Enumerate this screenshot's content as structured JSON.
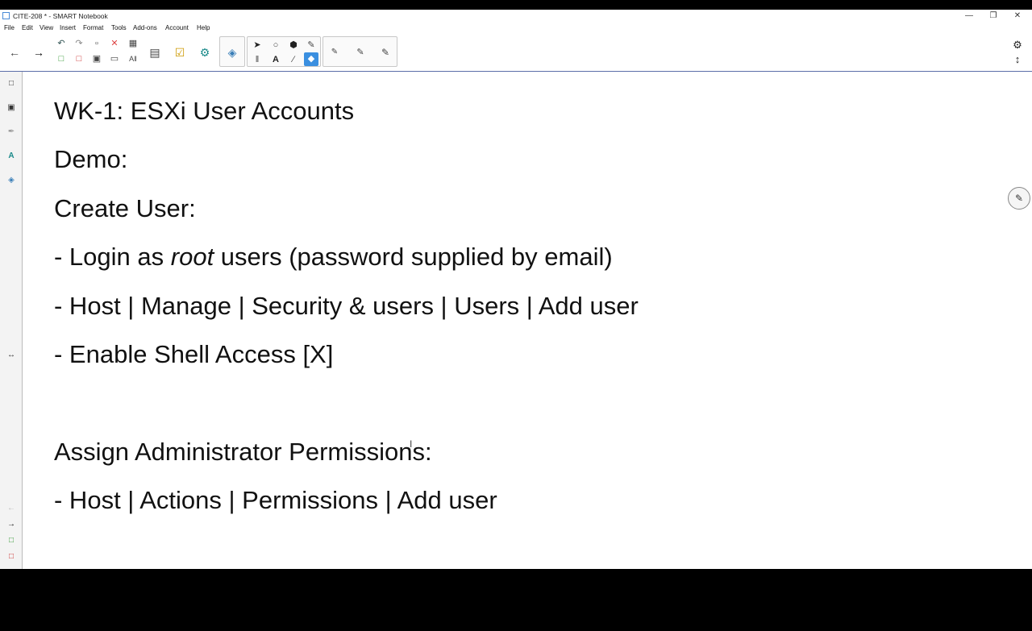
{
  "window": {
    "title": "CITE-208 * - SMART Notebook"
  },
  "menu": [
    "File",
    "Edit",
    "View",
    "Insert",
    "Format",
    "Tools",
    "Add-ons",
    "Account",
    "Help"
  ],
  "toolbar": {
    "icons": [
      "back-arrow-icon",
      "forward-arrow-icon",
      "undo-icon",
      "redo-icon",
      "paste-icon",
      "delete-icon",
      "table-icon",
      "screen-shade-icon",
      "capture-icon",
      "add-page-icon",
      "activity-builder-icon",
      "smart-response-icon",
      "select-icon",
      "shapes-icon",
      "fill-icon",
      "magic-pen-icon",
      "text-icon",
      "line-icon",
      "eraser-icon",
      "pen-icon"
    ]
  },
  "content": {
    "title": "WK-1: ESXi User Accounts",
    "demo": "Demo:",
    "create_user": "Create User:",
    "step1_prefix": "- Login as ",
    "step1_italic": "root",
    "step1_suffix": " users (password supplied by email)",
    "step2": "- Host | Manage | Security & users | Users | Add user",
    "step3": "- Enable Shell Access [X]",
    "assign": "Assign Administrator Permissions:",
    "step4": "- Host | Actions | Permissions | Add user"
  }
}
